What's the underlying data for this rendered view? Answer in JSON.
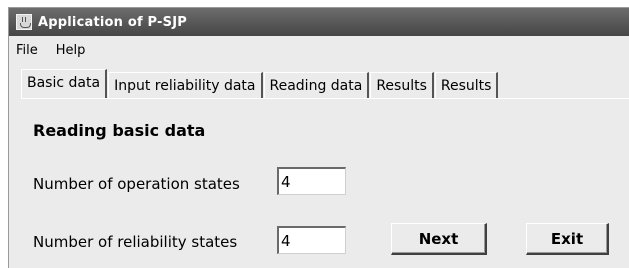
{
  "window": {
    "title": "Application of P-SJP",
    "icon": "java-cup-icon"
  },
  "menu": [
    "File",
    "Help"
  ],
  "tabs": [
    "Basic data",
    "Input reliability data",
    "Reading data",
    "Results",
    "Results"
  ],
  "active_tab": "Basic data",
  "form": {
    "heading": "Reading basic data",
    "operation_states_label": "Number of operation states",
    "operation_states_value": "4",
    "reliability_states_label": "Number of reliability states",
    "reliability_states_value": "4"
  },
  "buttons": {
    "next": "Next",
    "exit": "Exit"
  }
}
